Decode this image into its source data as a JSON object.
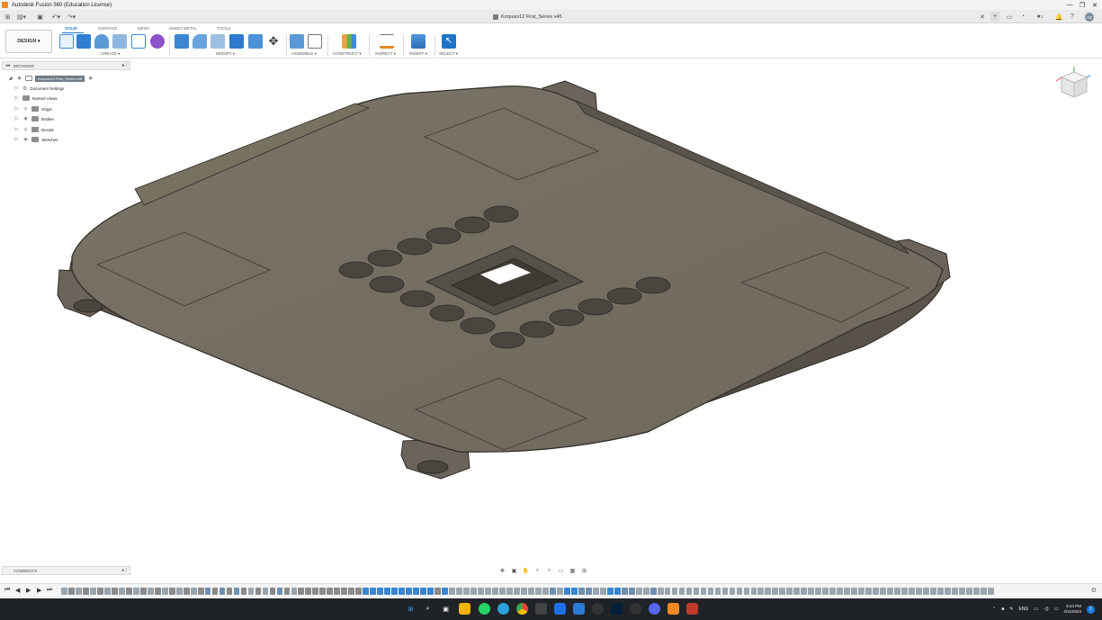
{
  "window": {
    "title": "Autodesk Fusion 360 (Education License)",
    "controls": [
      "—",
      "❐",
      "✕"
    ]
  },
  "appbar": {
    "document_title": "Korpusv12 First_Series v45",
    "close_tab_glyph": "✕",
    "user_initials": "AZ",
    "notification_count": "1",
    "quick_access_icons": [
      "grid-icon",
      "file-icon",
      "save-icon",
      "undo-icon",
      "redo-icon"
    ]
  },
  "toolbar": {
    "workspace": "DESIGN ▾",
    "tabs": [
      "SOLID",
      "SURFACE",
      "MESH",
      "SHEET METAL",
      "TOOLS"
    ],
    "active_tab": "SOLID",
    "groups": [
      {
        "label": "CREATE ▾"
      },
      {
        "label": "MODIFY ▾"
      },
      {
        "label": "ASSEMBLE ▾"
      },
      {
        "label": "CONSTRUCT ▾"
      },
      {
        "label": "INSPECT ▾"
      },
      {
        "label": "INSERT ▾"
      },
      {
        "label": "SELECT ▾"
      }
    ]
  },
  "browser": {
    "header": "BROWSER",
    "root": "Korpusv12 First_Series v45",
    "items": [
      {
        "label": "Document Settings",
        "icon": "gear-icon"
      },
      {
        "label": "Named Views",
        "icon": "folder-icon"
      },
      {
        "label": "Origin",
        "icon": "folder-icon"
      },
      {
        "label": "Bodies",
        "icon": "folder-icon"
      },
      {
        "label": "Decals",
        "icon": "folder-icon"
      },
      {
        "label": "Sketches",
        "icon": "folder-icon"
      }
    ]
  },
  "comments": {
    "label": "COMMENTS"
  },
  "navbar": {
    "icons": [
      "orbit-icon",
      "look-at-icon",
      "pan-icon",
      "zoom-icon",
      "fit-icon",
      "display-settings-icon",
      "grid-settings-icon",
      "viewports-icon"
    ]
  },
  "timeline": {
    "playback": [
      "⏮",
      "◀",
      "▶",
      "▶",
      "⏭"
    ],
    "feature_colors": [
      "#9aa4ad",
      "#6e8fb0",
      "#3b86d0",
      "#8a8a8a"
    ]
  },
  "taskbar": {
    "tray": {
      "lang": "ENG",
      "time": "5:24 PM",
      "date": "4/11/2023"
    }
  },
  "colors": {
    "accent": "#2479c9",
    "model": "#6b655c",
    "background": "#ffffff"
  }
}
